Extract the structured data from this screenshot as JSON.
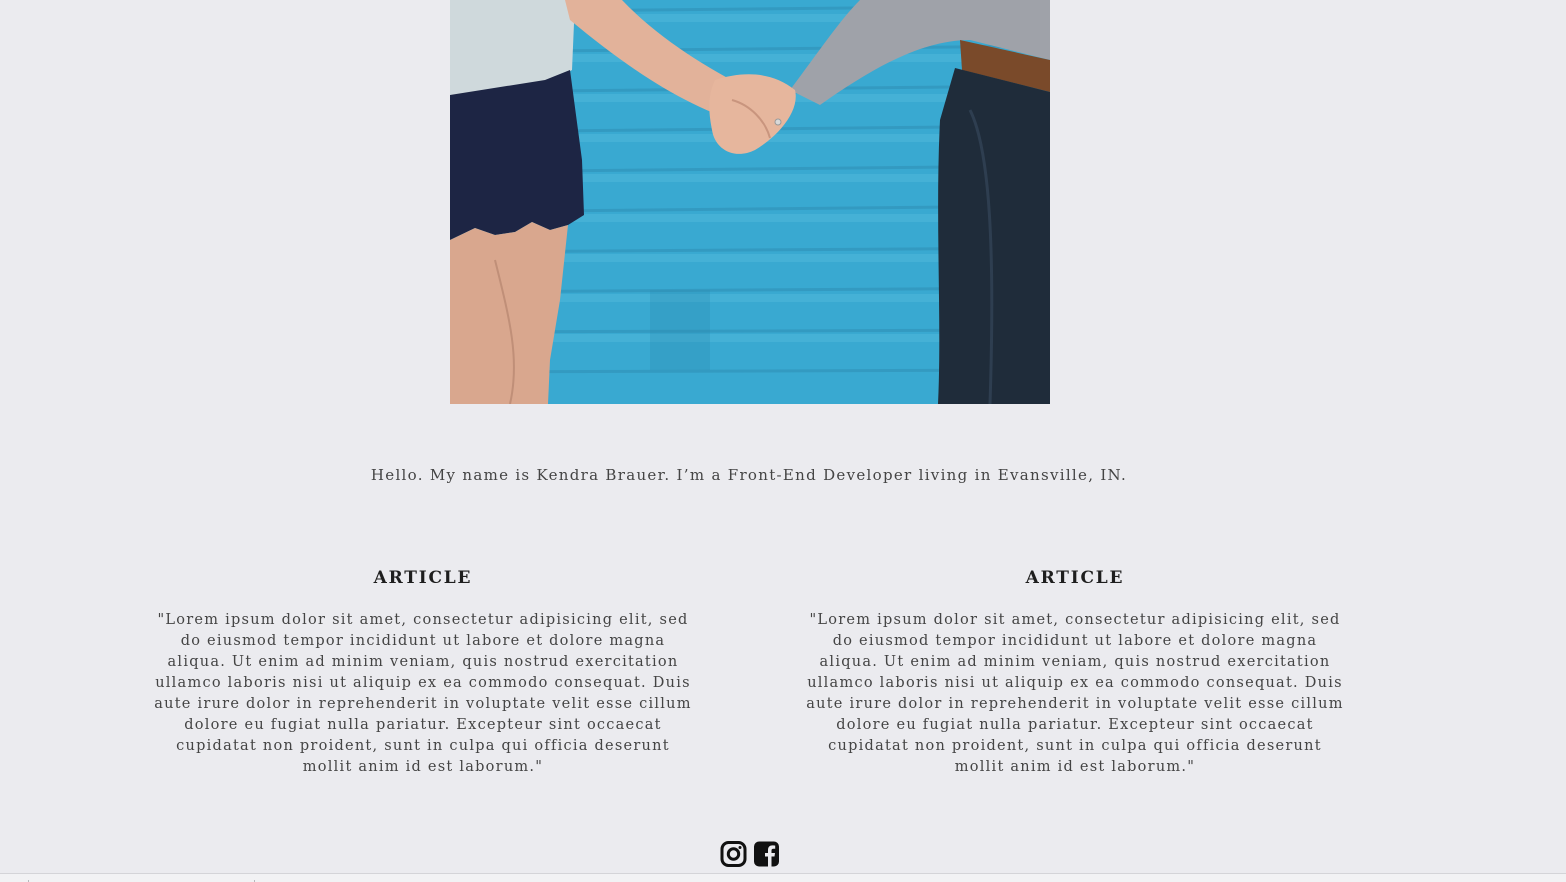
{
  "hero": {
    "image_alt": "Two people holding hands in front of a blue wall"
  },
  "intro": {
    "text": "Hello. My name is Kendra Brauer. I’m a Front-End Developer living in Evansville, IN."
  },
  "articles": [
    {
      "title": "ARTICLE",
      "body": "\"Lorem ipsum dolor sit amet, consectetur adipisicing elit, sed do eiusmod tempor incididunt ut labore et dolore magna aliqua. Ut enim ad minim veniam, quis nostrud exercitation ullamco laboris nisi ut aliquip ex ea commodo consequat. Duis aute irure dolor in reprehenderit in voluptate velit esse cillum dolore eu fugiat nulla pariatur. Excepteur sint occaecat cupidatat non proident, sunt in culpa qui officia deserunt mollit anim id est laborum.\""
    },
    {
      "title": "ARTICLE",
      "body": "\"Lorem ipsum dolor sit amet, consectetur adipisicing elit, sed do eiusmod tempor incididunt ut labore et dolore magna aliqua. Ut enim ad minim veniam, quis nostrud exercitation ullamco laboris nisi ut aliquip ex ea commodo consequat. Duis aute irure dolor in reprehenderit in voluptate velit esse cillum dolore eu fugiat nulla pariatur. Excepteur sint occaecat cupidatat non proident, sunt in culpa qui officia deserunt mollit anim id est laborum.\""
    }
  ],
  "social": {
    "icons": [
      "instagram-icon",
      "facebook-icon"
    ]
  },
  "colors": {
    "background": "#ebebef",
    "wall_blue": "#37a7cf",
    "text": "#444444",
    "heading": "#1e1e1e"
  }
}
